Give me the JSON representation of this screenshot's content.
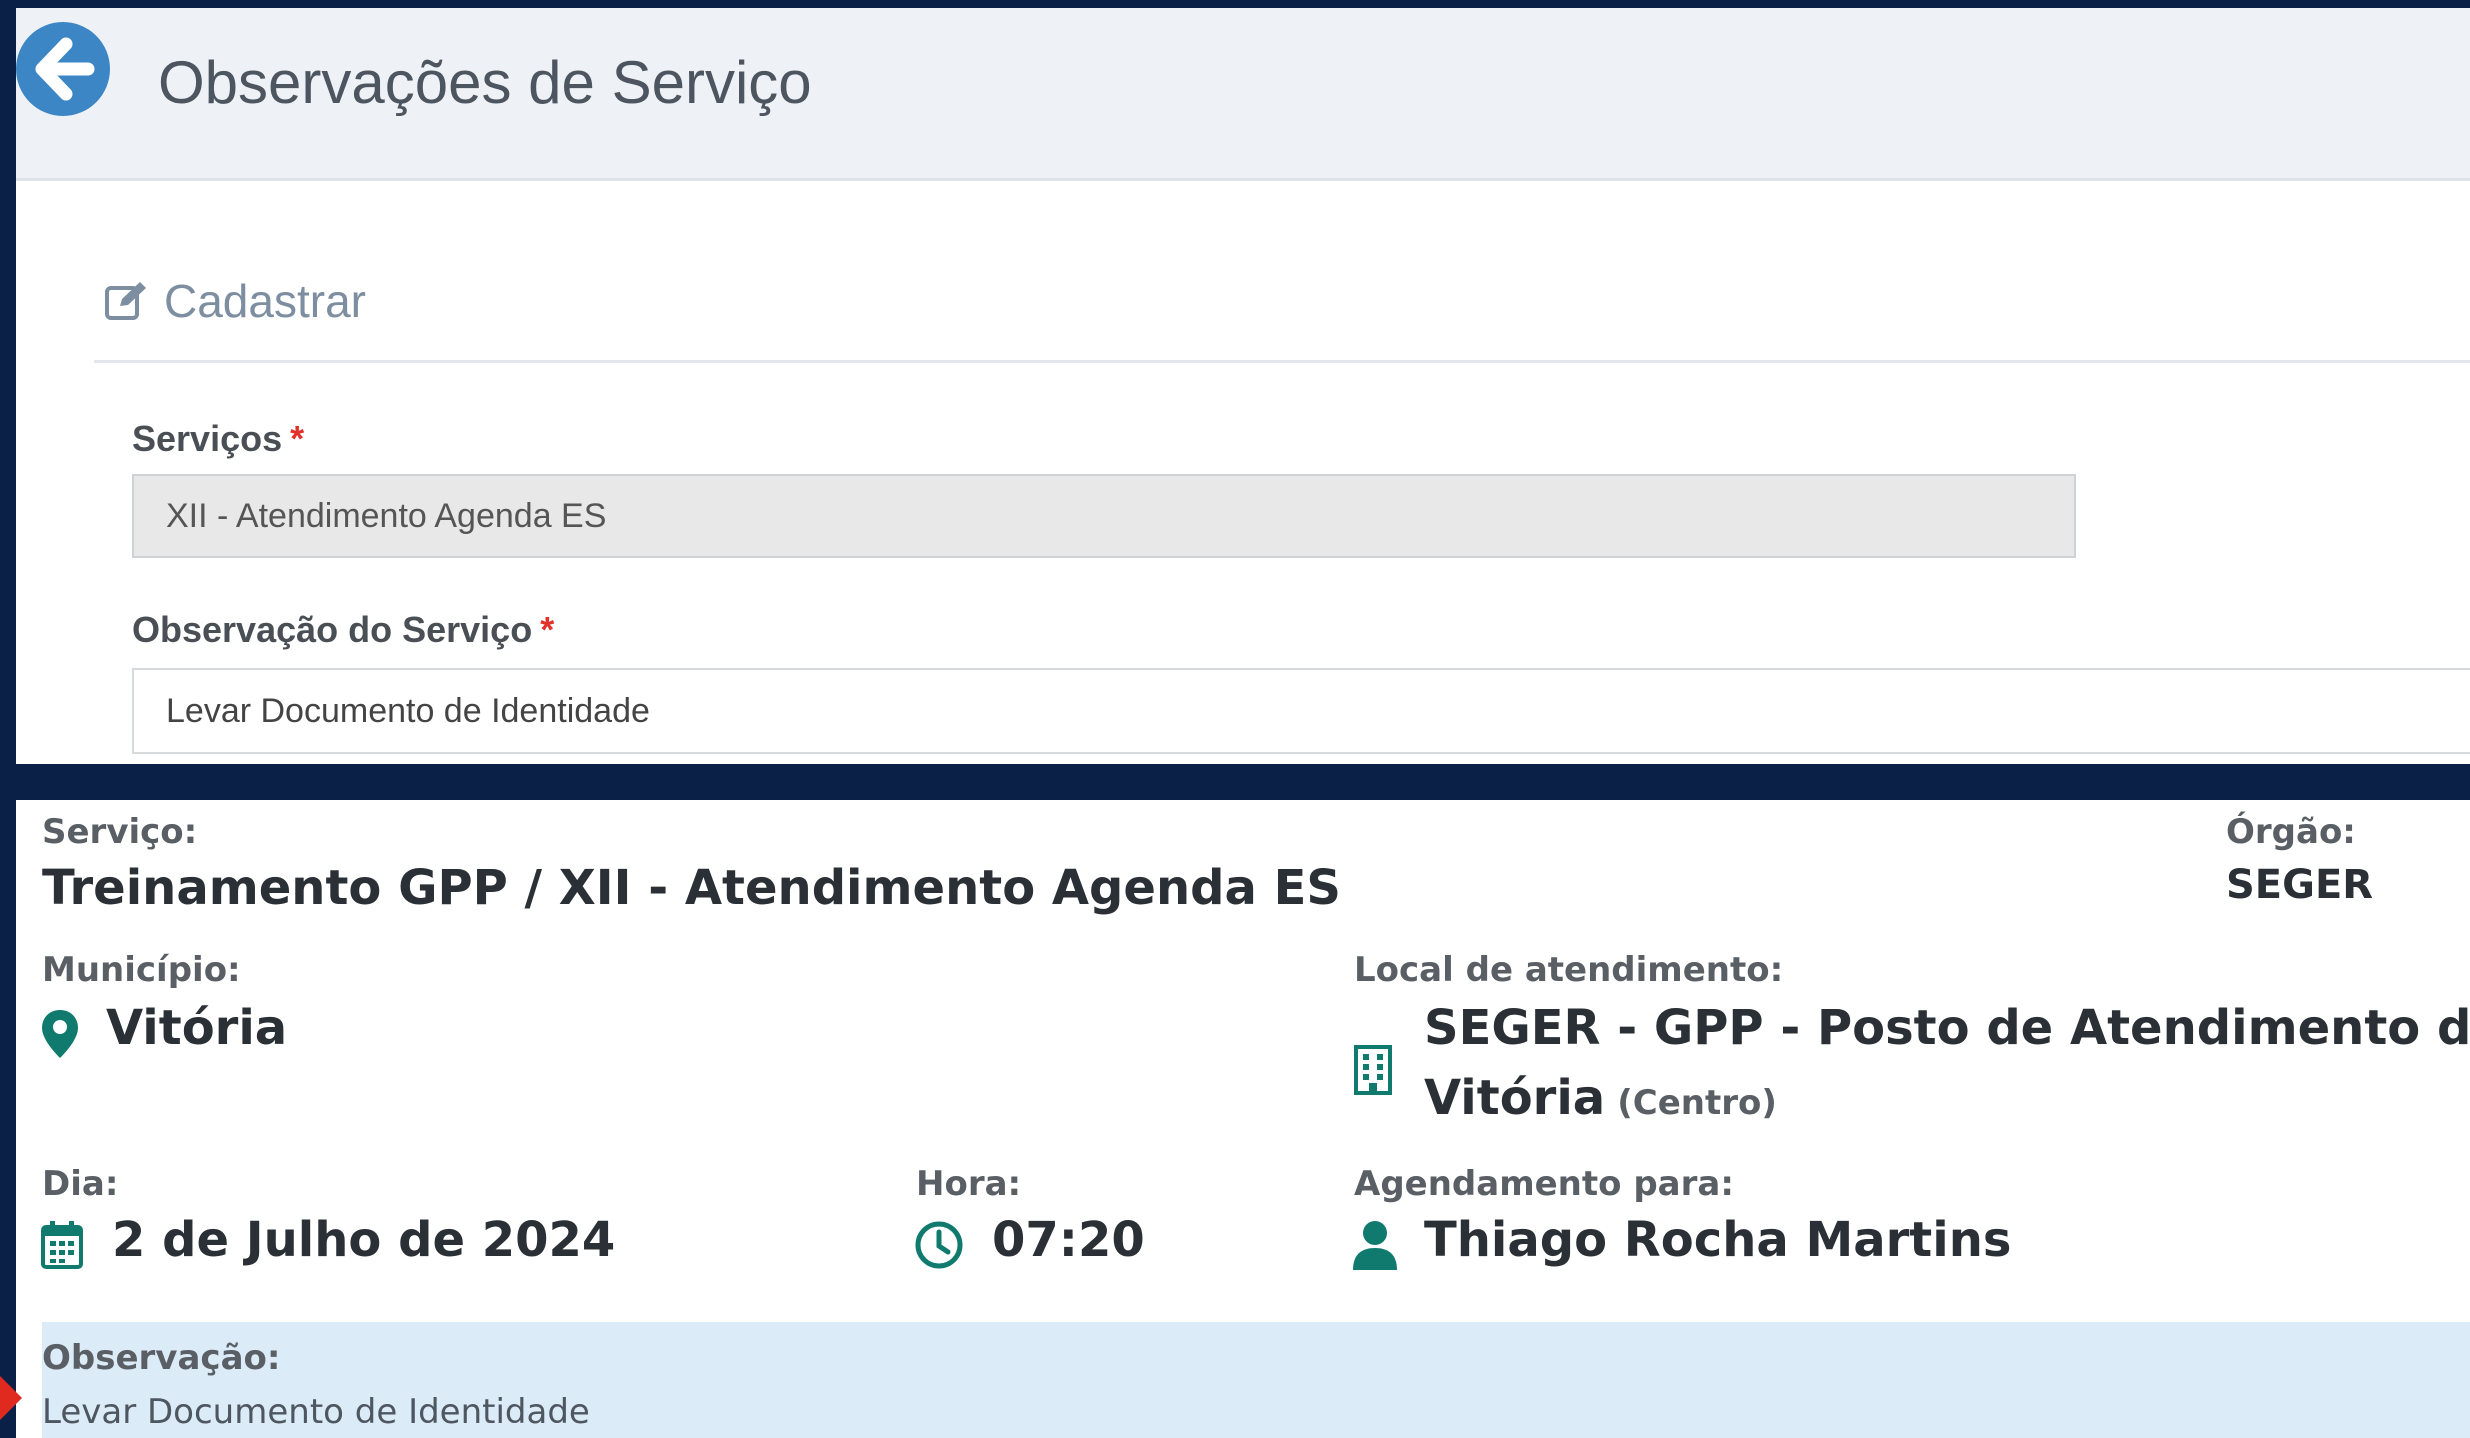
{
  "header": {
    "title": "Observações de Serviço"
  },
  "form": {
    "section_title": "Cadastrar",
    "services_label": "Serviços",
    "services_value": "XII - Atendimento Agenda ES",
    "observation_label": "Observação do Serviço",
    "observation_value": "Levar Documento de Identidade",
    "required_mark": "*"
  },
  "details": {
    "service_label": "Serviço:",
    "service_value": "Treinamento GPP / XII - Atendimento Agenda ES",
    "organ_label": "Órgão:",
    "organ_value": "SEGER",
    "municipality_label": "Município:",
    "municipality_value": "Vitória",
    "location_label": "Local de atendimento:",
    "location_line1": "SEGER - GPP - Posto de Atendimento de",
    "location_line2": "Vitória",
    "location_sub": "(Centro)",
    "day_label": "Dia:",
    "day_value": "2 de Julho de 2024",
    "time_label": "Hora:",
    "time_value": "07:20",
    "appointment_label": "Agendamento para:",
    "appointment_value": "Thiago Rocha Martins",
    "observation_label": "Observação:",
    "observation_value": "Levar Documento de Identidade"
  },
  "icons": {
    "back": "arrow-left-circle-icon",
    "edit": "edit-icon",
    "pin": "map-pin-icon",
    "building": "building-icon",
    "calendar": "calendar-icon",
    "clock": "clock-icon",
    "user": "user-icon"
  },
  "colors": {
    "brand_dark": "#0b2046",
    "back_button": "#3d86c6",
    "icon_teal": "#117a6f",
    "required": "#e0322b",
    "observation_bg": "#dcebf8"
  }
}
